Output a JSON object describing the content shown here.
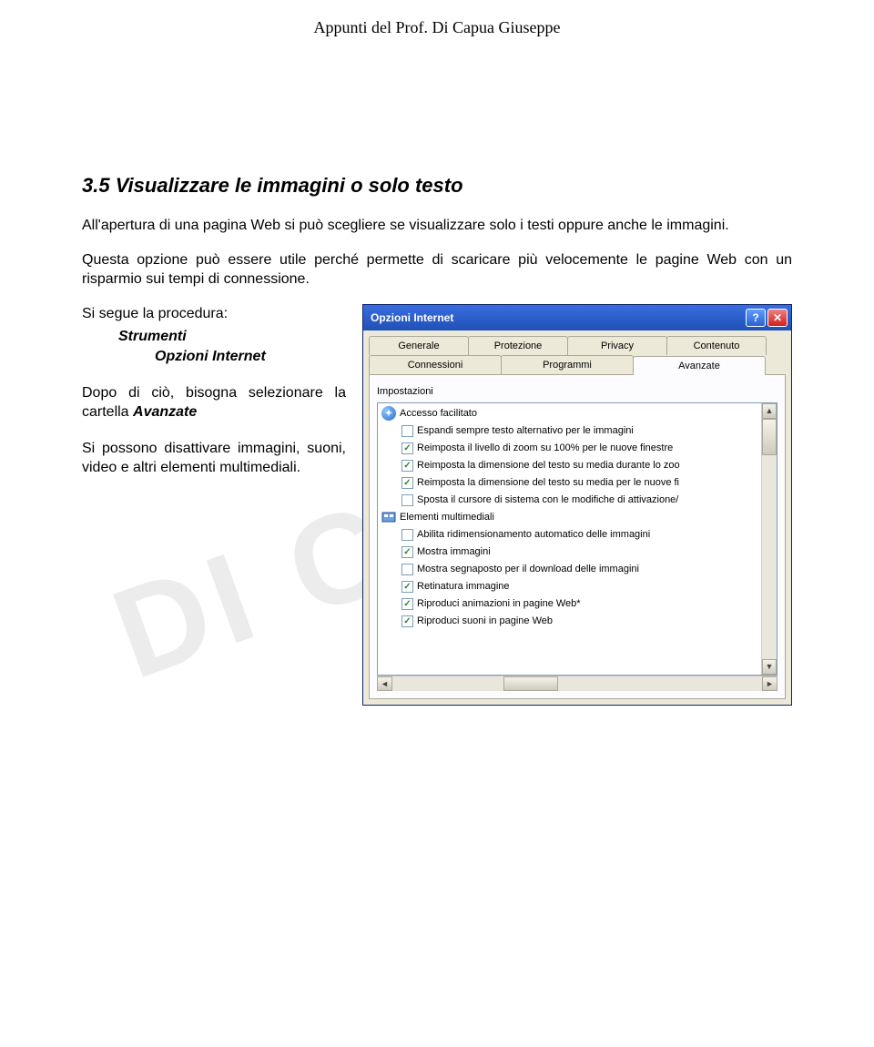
{
  "header": "Appunti del Prof. Di Capua Giuseppe",
  "watermark": "DI CAPUA",
  "section": {
    "title": "3.5 Visualizzare le immagini o solo testo",
    "para1": "All'apertura di una pagina Web si può scegliere se visualizzare solo i testi oppure anche le immagini.",
    "para2": "Questa opzione può essere utile perché permette di scaricare più velocemente le pagine Web con un risparmio sui tempi di connessione.",
    "proc_intro": "Si segue la procedura:",
    "proc_menu1": "Strumenti",
    "proc_menu2": "Opzioni Internet",
    "step2": "Dopo di ciò, bisogna selezionare la cartella ",
    "step2_bold": "Avanzate",
    "step3": "Si possono disattivare immagini, suoni, video e altri elementi multimediali."
  },
  "dialog": {
    "title": "Opzioni Internet",
    "tabs_row1": [
      "Generale",
      "Protezione",
      "Privacy",
      "Contenuto"
    ],
    "tabs_row2": [
      "Connessioni",
      "Programmi",
      "Avanzate"
    ],
    "active_tab": "Avanzate",
    "group_label": "Impostazioni",
    "groups": [
      {
        "icon": "blue",
        "label": "Accesso facilitato",
        "items": [
          {
            "checked": false,
            "label": "Espandi sempre testo alternativo per le immagini"
          },
          {
            "checked": true,
            "label": "Reimposta il livello di zoom su 100% per le nuove finestre"
          },
          {
            "checked": true,
            "label": "Reimposta la dimensione del testo su media durante lo zoo"
          },
          {
            "checked": true,
            "label": "Reimposta la dimensione del testo su media per le nuove fi"
          },
          {
            "checked": false,
            "label": "Sposta il cursore di sistema con le modifiche di attivazione/"
          }
        ]
      },
      {
        "icon": "mm",
        "label": "Elementi multimediali",
        "items": [
          {
            "checked": false,
            "label": "Abilita ridimensionamento automatico delle immagini"
          },
          {
            "checked": true,
            "label": "Mostra immagini"
          },
          {
            "checked": false,
            "label": "Mostra segnaposto per il download delle immagini"
          },
          {
            "checked": true,
            "label": "Retinatura immagine"
          },
          {
            "checked": true,
            "label": "Riproduci animazioni in pagine Web*"
          },
          {
            "checked": true,
            "label": "Riproduci suoni in pagine Web"
          }
        ]
      }
    ]
  }
}
